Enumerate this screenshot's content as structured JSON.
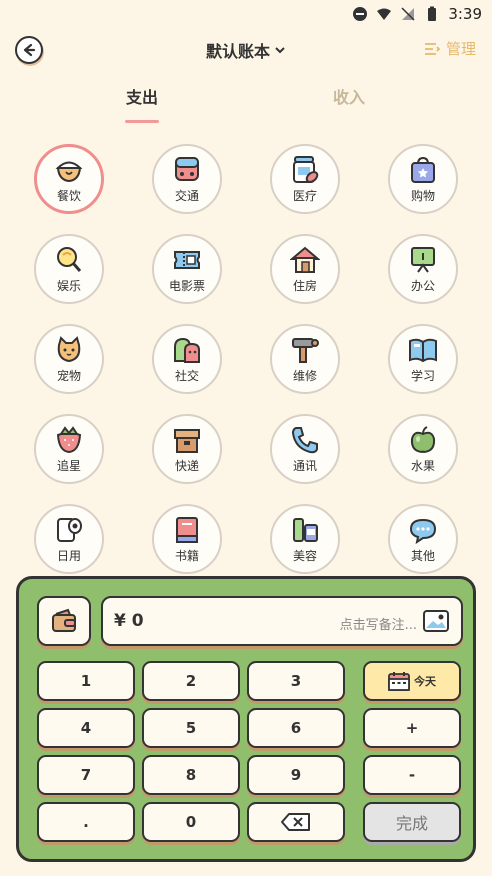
{
  "status_bar": {
    "time": "3:39"
  },
  "header": {
    "back_icon": "arrow-left-icon",
    "ledger_name": "默认账本",
    "ledger_chevron": "▾",
    "manage_label": "管理"
  },
  "tabs": [
    {
      "label": "支出",
      "active": true
    },
    {
      "label": "收入",
      "active": false
    }
  ],
  "categories": [
    {
      "label": "餐饮",
      "icon": "rice-bowl-icon",
      "selected": true
    },
    {
      "label": "交通",
      "icon": "bus-icon"
    },
    {
      "label": "医疗",
      "icon": "medicine-icon"
    },
    {
      "label": "购物",
      "icon": "shopping-bag-icon"
    },
    {
      "label": "娱乐",
      "icon": "lollipop-icon"
    },
    {
      "label": "电影票",
      "icon": "ticket-icon"
    },
    {
      "label": "住房",
      "icon": "house-icon"
    },
    {
      "label": "办公",
      "icon": "board-icon"
    },
    {
      "label": "宠物",
      "icon": "cat-icon"
    },
    {
      "label": "社交",
      "icon": "chat-people-icon"
    },
    {
      "label": "维修",
      "icon": "hammer-icon"
    },
    {
      "label": "学习",
      "icon": "book-open-icon"
    },
    {
      "label": "追星",
      "icon": "strawberry-icon"
    },
    {
      "label": "快递",
      "icon": "package-icon"
    },
    {
      "label": "通讯",
      "icon": "phone-icon"
    },
    {
      "label": "水果",
      "icon": "apple-icon"
    },
    {
      "label": "日用",
      "icon": "toilet-paper-icon"
    },
    {
      "label": "书籍",
      "icon": "book-icon"
    },
    {
      "label": "美容",
      "icon": "cosmetics-icon"
    },
    {
      "label": "其他",
      "icon": "more-bubble-icon"
    }
  ],
  "input": {
    "amount": "¥ 0",
    "note_placeholder": "点击写备注...",
    "wallet_icon": "wallet-icon",
    "image_icon": "image-icon"
  },
  "keys": {
    "k1": "1",
    "k2": "2",
    "k3": "3",
    "k4": "4",
    "k5": "5",
    "k6": "6",
    "k7": "7",
    "k8": "8",
    "k9": "9",
    "dot": ".",
    "k0": "0",
    "plus": "+",
    "minus": "-",
    "today": "今天",
    "done": "完成"
  },
  "colors": {
    "background": "#fdf6e6",
    "accent_pink": "#f08d8d",
    "keypad_green": "#8fbf6d",
    "manage_gold": "#e5b96d"
  }
}
